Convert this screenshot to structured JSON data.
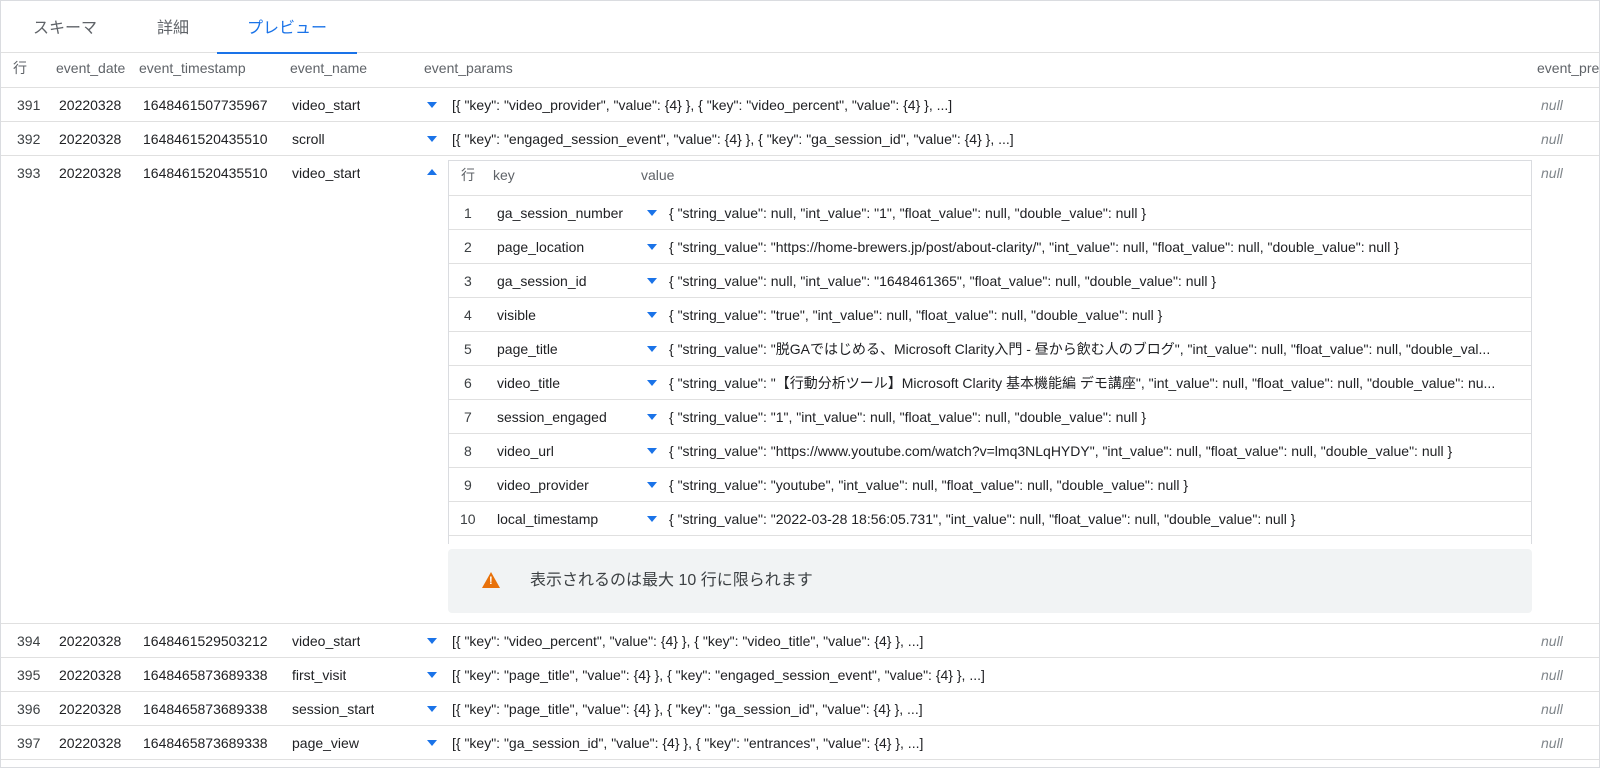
{
  "tabs": [
    {
      "label": "スキーマ"
    },
    {
      "label": "詳細"
    },
    {
      "label": "プレビュー"
    }
  ],
  "active_tab": "プレビュー",
  "columns": {
    "row": "行",
    "event_date": "event_date",
    "event_timestamp": "event_timestamp",
    "event_name": "event_name",
    "event_params": "event_params",
    "event_previous": "event_pre"
  },
  "rows": [
    {
      "num": "391",
      "date": "20220328",
      "ts": "1648461507735967",
      "name": "video_start",
      "params": "[{ \"key\": \"video_provider\", \"value\": {4} }, { \"key\": \"video_percent\", \"value\": {4} }, ...]",
      "prev": "null"
    },
    {
      "num": "392",
      "date": "20220328",
      "ts": "1648461520435510",
      "name": "scroll",
      "params": "[{ \"key\": \"engaged_session_event\", \"value\": {4} }, { \"key\": \"ga_session_id\", \"value\": {4} }, ...]",
      "prev": "null"
    },
    {
      "num": "393",
      "date": "20220328",
      "ts": "1648461520435510",
      "name": "video_start",
      "params": "",
      "prev": "null"
    },
    {
      "num": "394",
      "date": "20220328",
      "ts": "1648461529503212",
      "name": "video_start",
      "params": "[{ \"key\": \"video_percent\", \"value\": {4} }, { \"key\": \"video_title\", \"value\": {4} }, ...]",
      "prev": "null"
    },
    {
      "num": "395",
      "date": "20220328",
      "ts": "1648465873689338",
      "name": "first_visit",
      "params": "[{ \"key\": \"page_title\", \"value\": {4} }, { \"key\": \"engaged_session_event\", \"value\": {4} }, ...]",
      "prev": "null"
    },
    {
      "num": "396",
      "date": "20220328",
      "ts": "1648465873689338",
      "name": "session_start",
      "params": "[{ \"key\": \"page_title\", \"value\": {4} }, { \"key\": \"ga_session_id\", \"value\": {4} }, ...]",
      "prev": "null"
    },
    {
      "num": "397",
      "date": "20220328",
      "ts": "1648465873689338",
      "name": "page_view",
      "params": "[{ \"key\": \"ga_session_id\", \"value\": {4} }, { \"key\": \"entrances\", \"value\": {4} }, ...]",
      "prev": "null"
    }
  ],
  "nested": {
    "columns": {
      "row": "行",
      "key": "key",
      "value": "value"
    },
    "rows": [
      {
        "num": "1",
        "key": "ga_session_number",
        "value": "{ \"string_value\": null, \"int_value\": \"1\", \"float_value\": null, \"double_value\": null }"
      },
      {
        "num": "2",
        "key": "page_location",
        "value": "{ \"string_value\": \"https://home-brewers.jp/post/about-clarity/\", \"int_value\": null, \"float_value\": null, \"double_value\": null }"
      },
      {
        "num": "3",
        "key": "ga_session_id",
        "value": "{ \"string_value\": null, \"int_value\": \"1648461365\", \"float_value\": null, \"double_value\": null }"
      },
      {
        "num": "4",
        "key": "visible",
        "value": "{ \"string_value\": \"true\", \"int_value\": null, \"float_value\": null, \"double_value\": null }"
      },
      {
        "num": "5",
        "key": "page_title",
        "value": "{ \"string_value\": \"脱GAではじめる、Microsoft Clarity入門 - 昼から飲む人のブログ\", \"int_value\": null, \"float_value\": null, \"double_val..."
      },
      {
        "num": "6",
        "key": "video_title",
        "value": "{ \"string_value\": \"【行動分析ツール】Microsoft Clarity 基本機能編 デモ講座\", \"int_value\": null, \"float_value\": null, \"double_value\": nu..."
      },
      {
        "num": "7",
        "key": "session_engaged",
        "value": "{ \"string_value\": \"1\", \"int_value\": null, \"float_value\": null, \"double_value\": null }"
      },
      {
        "num": "8",
        "key": "video_url",
        "value": "{ \"string_value\": \"https://www.youtube.com/watch?v=lmq3NLqHYDY\", \"int_value\": null, \"float_value\": null, \"double_value\": null }"
      },
      {
        "num": "9",
        "key": "video_provider",
        "value": "{ \"string_value\": \"youtube\", \"int_value\": null, \"float_value\": null, \"double_value\": null }"
      },
      {
        "num": "10",
        "key": "local_timestamp",
        "value": "{ \"string_value\": \"2022-03-28 18:56:05.731\", \"int_value\": null, \"float_value\": null, \"double_value\": null }"
      }
    ]
  },
  "warning": {
    "text": "表示されるのは最大 10 行に限られます",
    "icon": "warning-icon"
  },
  "colors": {
    "accent": "#1a73e8",
    "warning": "#e8710a",
    "banner_bg": "#f1f3f4"
  }
}
